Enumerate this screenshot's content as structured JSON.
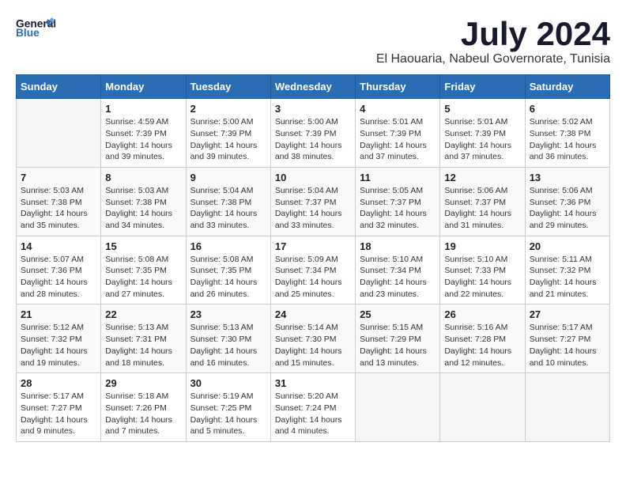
{
  "header": {
    "logo_general": "General",
    "logo_blue": "Blue",
    "month_year": "July 2024",
    "location": "El Haouaria, Nabeul Governorate, Tunisia"
  },
  "days_of_week": [
    "Sunday",
    "Monday",
    "Tuesday",
    "Wednesday",
    "Thursday",
    "Friday",
    "Saturday"
  ],
  "weeks": [
    [
      {
        "day": "",
        "sunrise": "",
        "sunset": "",
        "daylight": "",
        "empty": true
      },
      {
        "day": "1",
        "sunrise": "Sunrise: 4:59 AM",
        "sunset": "Sunset: 7:39 PM",
        "daylight": "Daylight: 14 hours and 39 minutes.",
        "empty": false
      },
      {
        "day": "2",
        "sunrise": "Sunrise: 5:00 AM",
        "sunset": "Sunset: 7:39 PM",
        "daylight": "Daylight: 14 hours and 39 minutes.",
        "empty": false
      },
      {
        "day": "3",
        "sunrise": "Sunrise: 5:00 AM",
        "sunset": "Sunset: 7:39 PM",
        "daylight": "Daylight: 14 hours and 38 minutes.",
        "empty": false
      },
      {
        "day": "4",
        "sunrise": "Sunrise: 5:01 AM",
        "sunset": "Sunset: 7:39 PM",
        "daylight": "Daylight: 14 hours and 37 minutes.",
        "empty": false
      },
      {
        "day": "5",
        "sunrise": "Sunrise: 5:01 AM",
        "sunset": "Sunset: 7:39 PM",
        "daylight": "Daylight: 14 hours and 37 minutes.",
        "empty": false
      },
      {
        "day": "6",
        "sunrise": "Sunrise: 5:02 AM",
        "sunset": "Sunset: 7:38 PM",
        "daylight": "Daylight: 14 hours and 36 minutes.",
        "empty": false
      }
    ],
    [
      {
        "day": "7",
        "sunrise": "Sunrise: 5:03 AM",
        "sunset": "Sunset: 7:38 PM",
        "daylight": "Daylight: 14 hours and 35 minutes.",
        "empty": false
      },
      {
        "day": "8",
        "sunrise": "Sunrise: 5:03 AM",
        "sunset": "Sunset: 7:38 PM",
        "daylight": "Daylight: 14 hours and 34 minutes.",
        "empty": false
      },
      {
        "day": "9",
        "sunrise": "Sunrise: 5:04 AM",
        "sunset": "Sunset: 7:38 PM",
        "daylight": "Daylight: 14 hours and 33 minutes.",
        "empty": false
      },
      {
        "day": "10",
        "sunrise": "Sunrise: 5:04 AM",
        "sunset": "Sunset: 7:37 PM",
        "daylight": "Daylight: 14 hours and 33 minutes.",
        "empty": false
      },
      {
        "day": "11",
        "sunrise": "Sunrise: 5:05 AM",
        "sunset": "Sunset: 7:37 PM",
        "daylight": "Daylight: 14 hours and 32 minutes.",
        "empty": false
      },
      {
        "day": "12",
        "sunrise": "Sunrise: 5:06 AM",
        "sunset": "Sunset: 7:37 PM",
        "daylight": "Daylight: 14 hours and 31 minutes.",
        "empty": false
      },
      {
        "day": "13",
        "sunrise": "Sunrise: 5:06 AM",
        "sunset": "Sunset: 7:36 PM",
        "daylight": "Daylight: 14 hours and 29 minutes.",
        "empty": false
      }
    ],
    [
      {
        "day": "14",
        "sunrise": "Sunrise: 5:07 AM",
        "sunset": "Sunset: 7:36 PM",
        "daylight": "Daylight: 14 hours and 28 minutes.",
        "empty": false
      },
      {
        "day": "15",
        "sunrise": "Sunrise: 5:08 AM",
        "sunset": "Sunset: 7:35 PM",
        "daylight": "Daylight: 14 hours and 27 minutes.",
        "empty": false
      },
      {
        "day": "16",
        "sunrise": "Sunrise: 5:08 AM",
        "sunset": "Sunset: 7:35 PM",
        "daylight": "Daylight: 14 hours and 26 minutes.",
        "empty": false
      },
      {
        "day": "17",
        "sunrise": "Sunrise: 5:09 AM",
        "sunset": "Sunset: 7:34 PM",
        "daylight": "Daylight: 14 hours and 25 minutes.",
        "empty": false
      },
      {
        "day": "18",
        "sunrise": "Sunrise: 5:10 AM",
        "sunset": "Sunset: 7:34 PM",
        "daylight": "Daylight: 14 hours and 23 minutes.",
        "empty": false
      },
      {
        "day": "19",
        "sunrise": "Sunrise: 5:10 AM",
        "sunset": "Sunset: 7:33 PM",
        "daylight": "Daylight: 14 hours and 22 minutes.",
        "empty": false
      },
      {
        "day": "20",
        "sunrise": "Sunrise: 5:11 AM",
        "sunset": "Sunset: 7:32 PM",
        "daylight": "Daylight: 14 hours and 21 minutes.",
        "empty": false
      }
    ],
    [
      {
        "day": "21",
        "sunrise": "Sunrise: 5:12 AM",
        "sunset": "Sunset: 7:32 PM",
        "daylight": "Daylight: 14 hours and 19 minutes.",
        "empty": false
      },
      {
        "day": "22",
        "sunrise": "Sunrise: 5:13 AM",
        "sunset": "Sunset: 7:31 PM",
        "daylight": "Daylight: 14 hours and 18 minutes.",
        "empty": false
      },
      {
        "day": "23",
        "sunrise": "Sunrise: 5:13 AM",
        "sunset": "Sunset: 7:30 PM",
        "daylight": "Daylight: 14 hours and 16 minutes.",
        "empty": false
      },
      {
        "day": "24",
        "sunrise": "Sunrise: 5:14 AM",
        "sunset": "Sunset: 7:30 PM",
        "daylight": "Daylight: 14 hours and 15 minutes.",
        "empty": false
      },
      {
        "day": "25",
        "sunrise": "Sunrise: 5:15 AM",
        "sunset": "Sunset: 7:29 PM",
        "daylight": "Daylight: 14 hours and 13 minutes.",
        "empty": false
      },
      {
        "day": "26",
        "sunrise": "Sunrise: 5:16 AM",
        "sunset": "Sunset: 7:28 PM",
        "daylight": "Daylight: 14 hours and 12 minutes.",
        "empty": false
      },
      {
        "day": "27",
        "sunrise": "Sunrise: 5:17 AM",
        "sunset": "Sunset: 7:27 PM",
        "daylight": "Daylight: 14 hours and 10 minutes.",
        "empty": false
      }
    ],
    [
      {
        "day": "28",
        "sunrise": "Sunrise: 5:17 AM",
        "sunset": "Sunset: 7:27 PM",
        "daylight": "Daylight: 14 hours and 9 minutes.",
        "empty": false
      },
      {
        "day": "29",
        "sunrise": "Sunrise: 5:18 AM",
        "sunset": "Sunset: 7:26 PM",
        "daylight": "Daylight: 14 hours and 7 minutes.",
        "empty": false
      },
      {
        "day": "30",
        "sunrise": "Sunrise: 5:19 AM",
        "sunset": "Sunset: 7:25 PM",
        "daylight": "Daylight: 14 hours and 5 minutes.",
        "empty": false
      },
      {
        "day": "31",
        "sunrise": "Sunrise: 5:20 AM",
        "sunset": "Sunset: 7:24 PM",
        "daylight": "Daylight: 14 hours and 4 minutes.",
        "empty": false
      },
      {
        "day": "",
        "sunrise": "",
        "sunset": "",
        "daylight": "",
        "empty": true
      },
      {
        "day": "",
        "sunrise": "",
        "sunset": "",
        "daylight": "",
        "empty": true
      },
      {
        "day": "",
        "sunrise": "",
        "sunset": "",
        "daylight": "",
        "empty": true
      }
    ]
  ]
}
